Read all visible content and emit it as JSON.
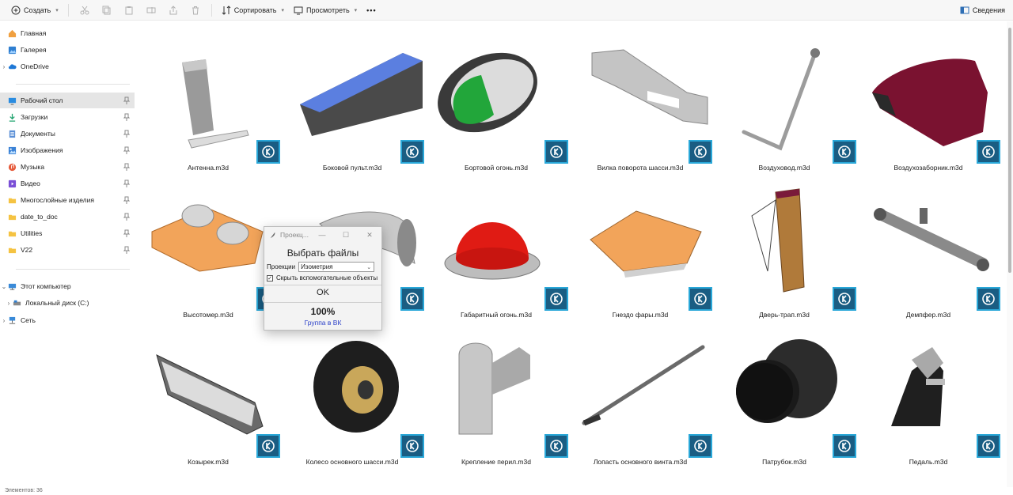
{
  "toolbar": {
    "create_label": "Создать",
    "sort_label": "Сортировать",
    "view_label": "Просмотреть",
    "more_label": "•••",
    "details_label": "Сведения"
  },
  "sidebar": {
    "top_items": [
      {
        "label": "Главная",
        "icon": "home-icon"
      },
      {
        "label": "Галерея",
        "icon": "gallery-icon"
      },
      {
        "label": "OneDrive",
        "icon": "cloud-icon"
      }
    ],
    "quick_access": [
      {
        "label": "Рабочий стол",
        "icon": "desktop-icon",
        "selected": true
      },
      {
        "label": "Загрузки",
        "icon": "download-icon"
      },
      {
        "label": "Документы",
        "icon": "document-icon"
      },
      {
        "label": "Изображения",
        "icon": "pictures-icon"
      },
      {
        "label": "Музыка",
        "icon": "music-icon"
      },
      {
        "label": "Видео",
        "icon": "video-icon"
      },
      {
        "label": "Многослойные изделия",
        "icon": "folder-icon"
      },
      {
        "label": "date_to_doc",
        "icon": "folder-icon"
      },
      {
        "label": "Utilities",
        "icon": "folder-icon"
      },
      {
        "label": "V22",
        "icon": "folder-icon"
      }
    ],
    "computer": [
      {
        "label": "Этот компьютер",
        "icon": "computer-icon"
      },
      {
        "label": "Локальный диск (C:)",
        "icon": "drive-icon"
      },
      {
        "label": "Сеть",
        "icon": "network-icon"
      }
    ]
  },
  "files": [
    {
      "name": "Антенна.m3d",
      "icon": "antenna-model-icon"
    },
    {
      "name": "Боковой пульт.m3d",
      "icon": "side-panel-model-icon"
    },
    {
      "name": "Бортовой огонь.m3d",
      "icon": "board-light-model-icon"
    },
    {
      "name": "Вилка поворота шасси.m3d",
      "icon": "fork-model-icon"
    },
    {
      "name": "Воздуховод.m3d",
      "icon": "air-duct-model-icon"
    },
    {
      "name": "Воздухозаборник.m3d",
      "icon": "air-intake-model-icon"
    },
    {
      "name": "Высотомер.m3d",
      "icon": "altimeter-model-icon"
    },
    {
      "name": "",
      "icon": "pipe-elbow-model-icon"
    },
    {
      "name": "Габаритный огонь.m3d",
      "icon": "dome-light-model-icon"
    },
    {
      "name": "Гнездо фары.m3d",
      "icon": "headlight-socket-model-icon"
    },
    {
      "name": "Дверь-трап.m3d",
      "icon": "door-ramp-model-icon"
    },
    {
      "name": "Демпфер.m3d",
      "icon": "damper-model-icon"
    },
    {
      "name": "Козырек.m3d",
      "icon": "visor-model-icon"
    },
    {
      "name": "Колесо основного шасси.m3d",
      "icon": "wheel-model-icon"
    },
    {
      "name": "Крепление перил.m3d",
      "icon": "rail-mount-model-icon"
    },
    {
      "name": "Лопасть основного винта.m3d",
      "icon": "rotor-blade-model-icon"
    },
    {
      "name": "Патрубок.m3d",
      "icon": "nozzle-model-icon"
    },
    {
      "name": "Педаль.m3d",
      "icon": "pedal-model-icon"
    }
  ],
  "dialog": {
    "title": "Проекц...",
    "heading": "Выбрать файлы",
    "projection_label": "Проекции",
    "projection_value": "Изометрия",
    "hide_aux_label": "Скрыть вспомогательные объекты",
    "hide_aux_checked": "✓",
    "ok_label": "OK",
    "progress_text": "100%",
    "progress_value": 1.0,
    "link_label": "Группа в ВК"
  },
  "status": {
    "text": "Элементов: 36"
  },
  "colors": {
    "badge_bg": "#1a5d83",
    "badge_border": "#29a7d8",
    "selected_nav": "#e5e5e5",
    "link": "#2b40c8"
  }
}
